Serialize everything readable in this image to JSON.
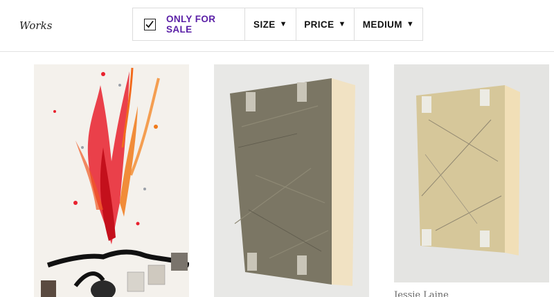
{
  "header": {
    "title": "Works"
  },
  "filters": {
    "only_for_sale": {
      "label": "ONLY FOR SALE",
      "checked": true,
      "color": "#5a1fa6"
    },
    "size": {
      "label": "SIZE"
    },
    "price": {
      "label": "PRICE"
    },
    "medium": {
      "label": "MEDIUM"
    }
  },
  "artworks": [
    {
      "artist": ""
    },
    {
      "artist": ""
    },
    {
      "artist": "Jessie Laine"
    }
  ]
}
